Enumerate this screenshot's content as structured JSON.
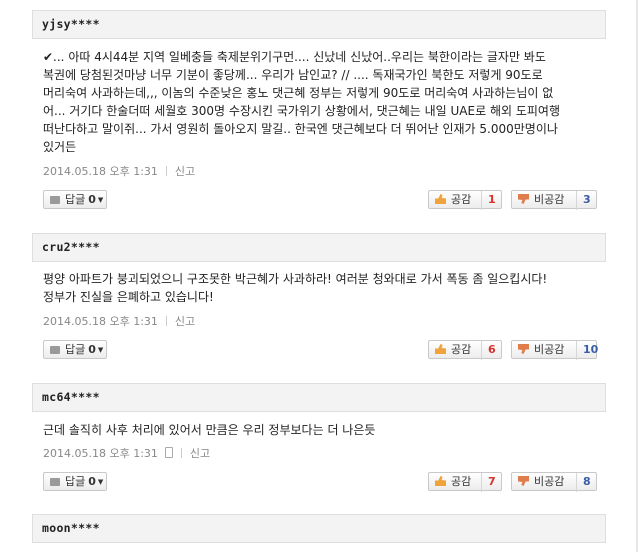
{
  "comments": [
    {
      "user": "yjsy****",
      "lines": [
        "✔... 아따 4시44분 지역 일베충들 축제분위기구먼.... 신났네 신났어..우리는 북한이라는 글자만 봐도",
        "복권에 당첨된것마냥 너무 기분이 좋당께... 우리가 남인교? // .... 독재국가인 북한도 저렇게 90도로",
        "머리숙여 사과하는데,,, 이놈의 수준낮은 홍노 댓근혜 정부는 저렇게 90도로 머리숙여 사과하는님이 없",
        "어... 거기다 한술더떠 세월호 300명 수장시킨 국가위기 상황에서, 댓근혜는 내일 UAE로 해외 도피여행",
        "떠난다하고 말이쥐... 가서 영원히 돌아오지 말길.. 한국엔 댓근혜보다 더 뛰어난 인재가 5.000만명이나",
        "있거든"
      ],
      "date": "2014.05.18 오후 1:31",
      "report": "신고",
      "mobile": false,
      "reply_label": "답글",
      "reply_count": "0",
      "like_label": "공감",
      "like_count": "1",
      "dislike_label": "비공감",
      "dislike_count": "3"
    },
    {
      "user": "cru2****",
      "lines": [
        "평양 아파트가 붕괴되었으니 구조못한 박근혜가 사과하라! 여러분 청와대로 가서 폭동 좀 일으킵시다!",
        "정부가 진실을 은폐하고 있습니다!"
      ],
      "date": "2014.05.18 오후 1:31",
      "report": "신고",
      "mobile": false,
      "reply_label": "답글",
      "reply_count": "0",
      "like_label": "공감",
      "like_count": "6",
      "dislike_label": "비공감",
      "dislike_count": "10"
    },
    {
      "user": "mc64****",
      "lines": [
        "근데 솔직히 사후 처리에 있어서 만큼은 우리 정부보다는 더 나은듯"
      ],
      "date": "2014.05.18 오후 1:31",
      "report": "신고",
      "mobile": true,
      "reply_label": "답글",
      "reply_count": "0",
      "like_label": "공감",
      "like_count": "7",
      "dislike_label": "비공감",
      "dislike_count": "8"
    },
    {
      "user": "moon****"
    }
  ]
}
